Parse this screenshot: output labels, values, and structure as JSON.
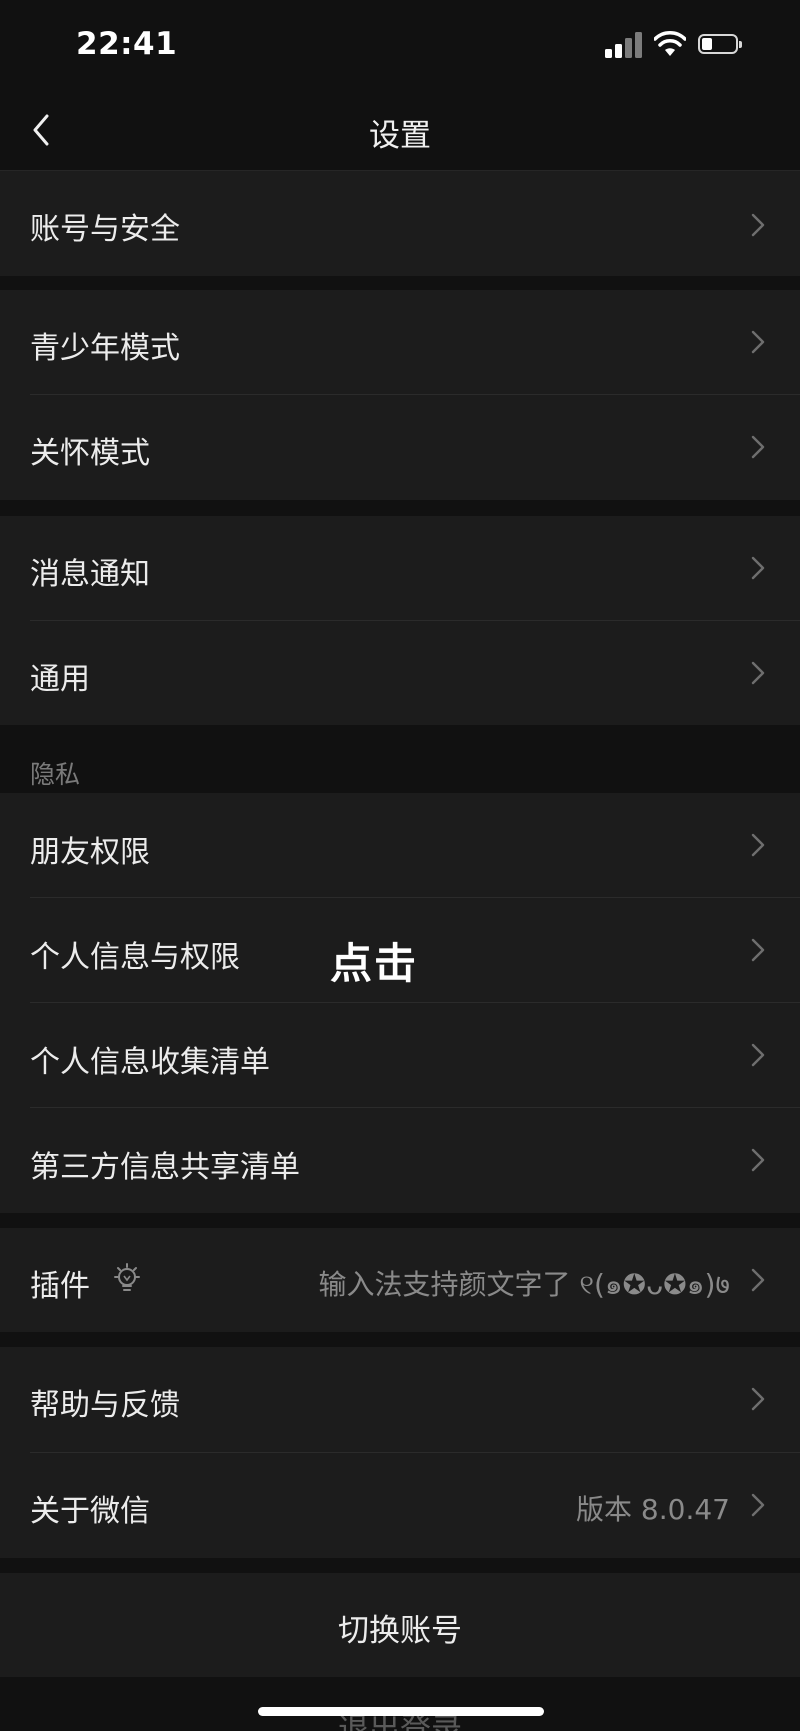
{
  "status_bar": {
    "time": "22:41",
    "icons": [
      "cellular-signal-icon",
      "wifi-icon",
      "battery-icon"
    ]
  },
  "nav": {
    "title": "设置",
    "back_icon": "chevron-left-icon"
  },
  "groups": {
    "account": {
      "label": "账号与安全"
    },
    "youth": {
      "label": "青少年模式"
    },
    "care": {
      "label": "关怀模式"
    },
    "notify": {
      "label": "消息通知"
    },
    "general": {
      "label": "通用"
    },
    "privacy_header": "隐私",
    "friend_perm": {
      "label": "朋友权限"
    },
    "personal_perm": {
      "label": "个人信息与权限"
    },
    "collect_list": {
      "label": "个人信息收集清单"
    },
    "share_list": {
      "label": "第三方信息共享清单"
    },
    "plugins": {
      "label": "插件",
      "value": "输入法支持颜文字了 ୧(๑✪ᴗ✪๑)७",
      "icon": "lightbulb-icon"
    },
    "help": {
      "label": "帮助与反馈"
    },
    "about": {
      "label": "关于微信",
      "value": "版本 8.0.47"
    }
  },
  "overlay": {
    "annotation": "点击"
  },
  "switch_account": {
    "label": "切换账号"
  },
  "logout": {
    "label": "退出登录"
  },
  "colors": {
    "background": "#111111",
    "cell": "#1c1c1c",
    "text": "#ececec",
    "secondary": "#8a8a8a"
  }
}
